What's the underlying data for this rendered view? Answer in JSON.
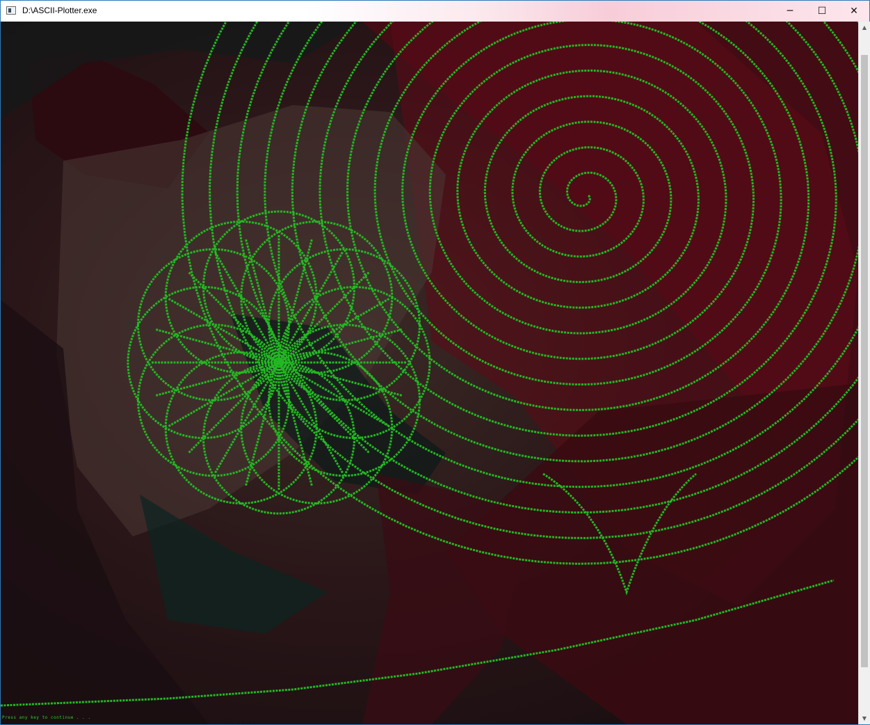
{
  "window": {
    "title": "D:\\ASCII-Plotter.exe",
    "icon": "console-icon",
    "controls": {
      "minimize": "─",
      "maximize": "☐",
      "close": "✕"
    }
  },
  "console": {
    "prompt": "Press any key to continue . . .",
    "plot_color": "#22b922",
    "background_tint": "#5a0f1a"
  },
  "scrollbar": {
    "up_arrow": "▲",
    "down_arrow": "▼"
  }
}
